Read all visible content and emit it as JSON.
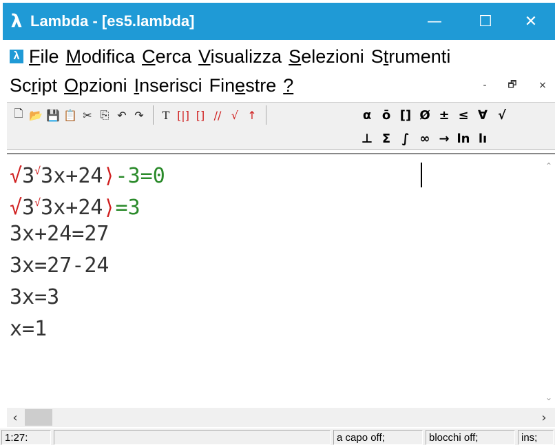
{
  "window": {
    "title": "Lambda - [es5.lambda]",
    "app_icon": "lambda-icon",
    "controls": {
      "minimize": "—",
      "maximize": "☐",
      "close": "✕"
    },
    "accent_color": "#1f9ad6"
  },
  "menu": {
    "row1": [
      {
        "pre": "",
        "key": "F",
        "post": "ile"
      },
      {
        "pre": "",
        "key": "M",
        "post": "odifica"
      },
      {
        "pre": "",
        "key": "C",
        "post": "erca"
      },
      {
        "pre": "",
        "key": "V",
        "post": "isualizza"
      },
      {
        "pre": "",
        "key": "S",
        "post": "elezioni"
      },
      {
        "pre": "S",
        "key": "t",
        "post": "rumenti"
      }
    ],
    "row2": [
      {
        "pre": "Sc",
        "key": "r",
        "post": "ipt"
      },
      {
        "pre": "",
        "key": "O",
        "post": "pzioni"
      },
      {
        "pre": "",
        "key": "I",
        "post": "nserisci"
      },
      {
        "pre": "Fin",
        "key": "e",
        "post": "stre"
      },
      {
        "pre": "",
        "key": "?",
        "post": ""
      }
    ],
    "mdi": {
      "minimize": "-",
      "restore": "🗗",
      "close": "×"
    }
  },
  "toolbar": {
    "file_tools": [
      "new-icon",
      "open-icon",
      "save-icon",
      "paste-icon",
      "cut-icon",
      "copy-icon",
      "undo-icon",
      "redo-icon"
    ],
    "math_row1": [
      "α",
      "ō",
      "[]",
      "Ø",
      "±",
      "≤",
      "∀",
      "√"
    ],
    "math_row2": [
      "⊥",
      "Σ",
      "∫",
      "∞",
      "→",
      "ln",
      "lı"
    ]
  },
  "editor": {
    "lines": [
      {
        "a": "√",
        "b": "3",
        "c": "√",
        "d": "3x+24",
        "e": "⟩",
        "f": "-3=0"
      },
      {
        "a": "√",
        "b": "3",
        "c": "√",
        "d": "3x+24",
        "e": "⟩",
        "f": "=3"
      },
      {
        "text": "3x+24=27"
      },
      {
        "text": "3x=27-24"
      },
      {
        "text": "3x=3"
      },
      {
        "text": "x=1"
      }
    ]
  },
  "status": {
    "position": "1:27:",
    "wrap": "a capo off;",
    "blocks": "blocchi off;",
    "mode": "ins;"
  }
}
